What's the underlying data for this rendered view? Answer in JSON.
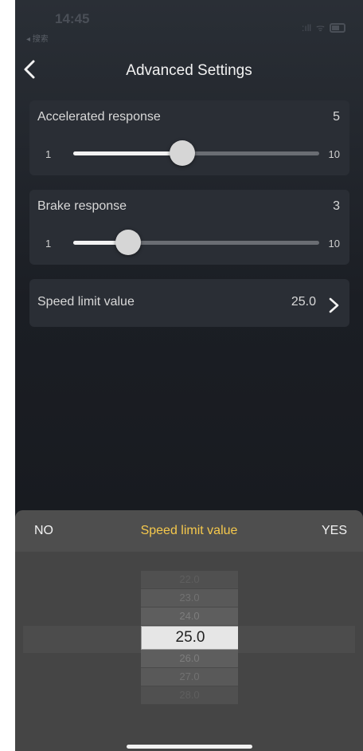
{
  "status_bar": {
    "time": "14:45",
    "back_app": "◂ 搜索",
    "signal": ":ıll",
    "wifi": "ᯤ"
  },
  "nav": {
    "title": "Advanced Settings"
  },
  "settings": {
    "accelerated": {
      "label": "Accelerated response",
      "value": "5",
      "min": "1",
      "max": "10",
      "level": 5
    },
    "brake": {
      "label": "Brake response",
      "value": "3",
      "min": "1",
      "max": "10",
      "level": 3
    },
    "speed_limit": {
      "label": "Speed limit value",
      "value": "25.0"
    }
  },
  "sheet": {
    "cancel_label": "NO",
    "title": "Speed limit value",
    "confirm_label": "YES",
    "options": [
      "22.0",
      "23.0",
      "24.0",
      "25.0",
      "26.0",
      "27.0",
      "28.0"
    ],
    "selected": "25.0"
  },
  "colors": {
    "accent": "#f5c84c",
    "background": "#1b1e24",
    "card": "#2a2e35"
  }
}
